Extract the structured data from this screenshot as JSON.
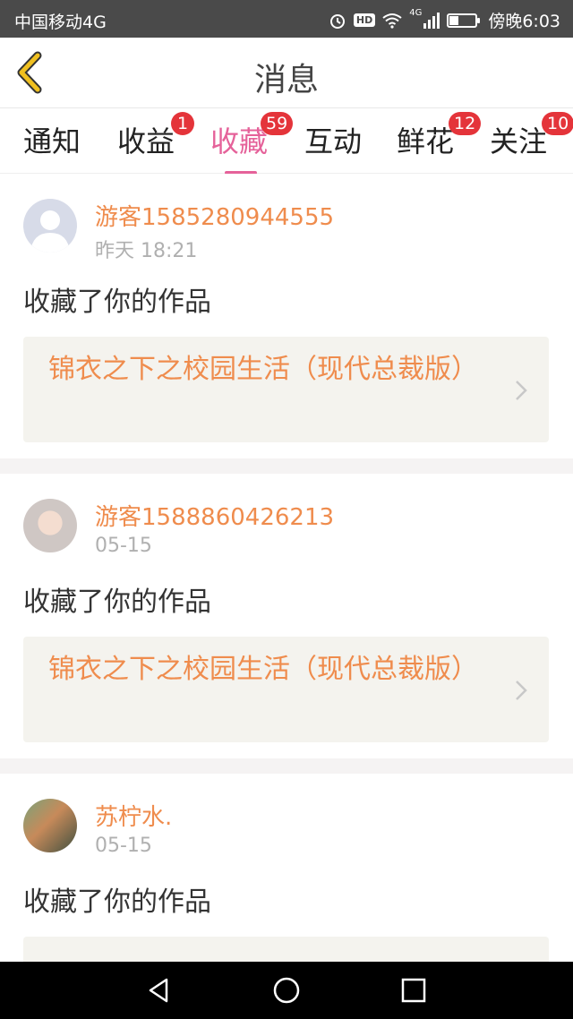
{
  "status_bar": {
    "carrier": "中国移动4G",
    "hd": "HD",
    "network": "4G",
    "time": "傍晚6:03",
    "battery_level": 0.35,
    "icons": [
      "alarm-icon",
      "hd-icon",
      "wifi-icon",
      "signal-icon",
      "battery-icon"
    ]
  },
  "header": {
    "title": "消息",
    "back_icon": "back-chevron-icon",
    "accent": "#f0c020"
  },
  "tabs": [
    {
      "label": "通知",
      "badge": "",
      "active": false
    },
    {
      "label": "收益",
      "badge": "1",
      "active": false
    },
    {
      "label": "收藏",
      "badge": "59",
      "active": true
    },
    {
      "label": "互动",
      "badge": "",
      "active": false
    },
    {
      "label": "鲜花",
      "badge": "12",
      "active": false
    },
    {
      "label": "关注",
      "badge": "10",
      "active": false
    }
  ],
  "colors": {
    "active_tab": "#e5629a",
    "badge": "#e4343a",
    "username": "#ef8c4d"
  },
  "messages": [
    {
      "user": "游客1585280944555",
      "time": "昨天 18:21",
      "text": "收藏了你的作品",
      "work": "锦衣之下之校园生活（现代总裁版）"
    },
    {
      "user": "游客1588860426213",
      "time": "05-15",
      "text": "收藏了你的作品",
      "work": "锦衣之下之校园生活（现代总裁版）"
    },
    {
      "user": "苏柠水.",
      "time": "05-15",
      "text": "收藏了你的作品",
      "work": ""
    }
  ],
  "nav": [
    "back-triangle-icon",
    "home-circle-icon",
    "recent-square-icon"
  ]
}
